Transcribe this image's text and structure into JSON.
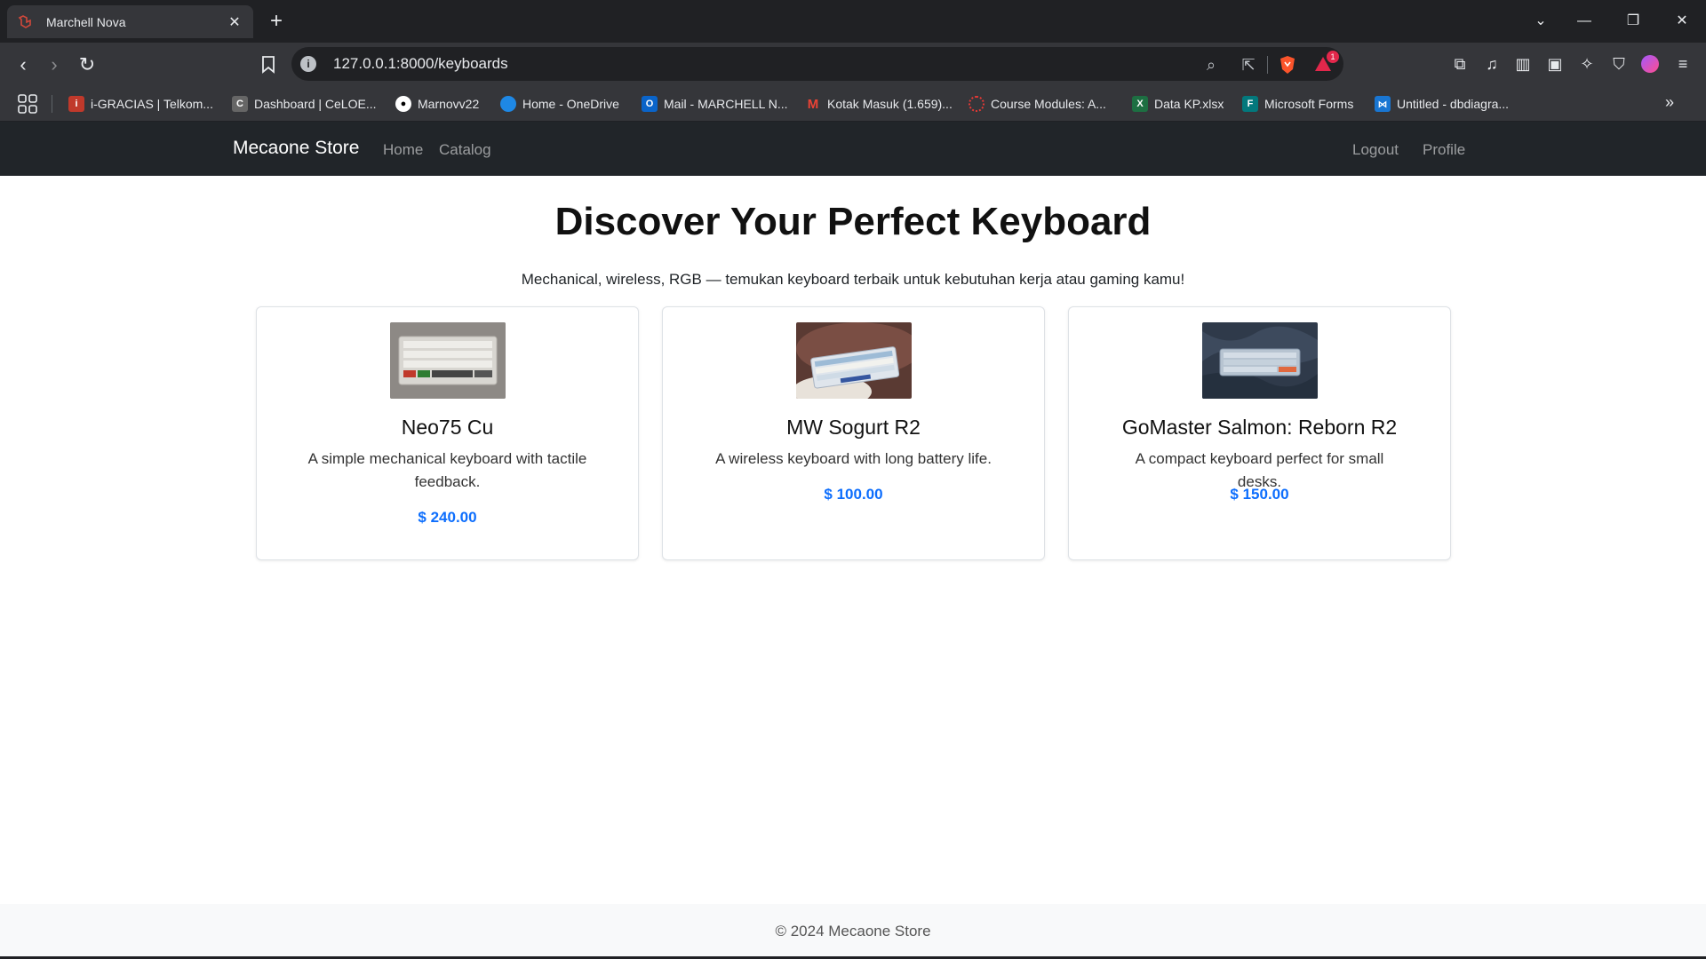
{
  "browser": {
    "tab": {
      "title": "Marchell Nova",
      "close_glyph": "✕"
    },
    "new_tab_glyph": "+",
    "address": {
      "url": "127.0.0.1:8000/keyboards"
    },
    "notification_badge": "1",
    "bookmarks": [
      {
        "label": "i-GRACIAS | Telkom...",
        "icon": "igracias-icon",
        "color": "#c0392b"
      },
      {
        "label": "Dashboard | CeLOE...",
        "icon": "celoe-icon",
        "color": "#666666"
      },
      {
        "label": "Marnovv22",
        "icon": "github-icon",
        "color": "#ffffff"
      },
      {
        "label": "Home - OneDrive",
        "icon": "onedrive-icon",
        "color": "#1e88e5"
      },
      {
        "label": "Mail - MARCHELL N...",
        "icon": "outlook-icon",
        "color": "#0a64c9"
      },
      {
        "label": "Kotak Masuk (1.659)...",
        "icon": "gmail-icon",
        "color": "#ea4335"
      },
      {
        "label": "Course Modules: A...",
        "icon": "course-icon",
        "color": "#e53935"
      },
      {
        "label": "Data KP.xlsx",
        "icon": "excel-icon",
        "color": "#1d6f42"
      },
      {
        "label": "Microsoft Forms",
        "icon": "forms-icon",
        "color": "#03787c"
      },
      {
        "label": "Untitled - dbdiagra...",
        "icon": "dbdiagram-icon",
        "color": "#1976d2"
      }
    ]
  },
  "site": {
    "brand": "Mecaone Store",
    "nav_left": [
      "Home",
      "Catalog"
    ],
    "nav_right": [
      "Logout",
      "Profile"
    ],
    "hero_title": "Discover Your Perfect Keyboard",
    "hero_subtitle": "Mechanical, wireless, RGB — temukan keyboard terbaik untuk kebutuhan kerja atau gaming kamu!",
    "products": [
      {
        "name": "Neo75 Cu",
        "description": "A simple mechanical keyboard with tactile feedback.",
        "price": "$ 240.00"
      },
      {
        "name": "MW Sogurt R2",
        "description": "A wireless keyboard with long battery life.",
        "price": "$ 100.00"
      },
      {
        "name": "GoMaster Salmon: Reborn R2",
        "description": "A compact keyboard perfect for small desks.",
        "price": "$ 150.00"
      }
    ],
    "footer": "© 2024 Mecaone Store"
  }
}
